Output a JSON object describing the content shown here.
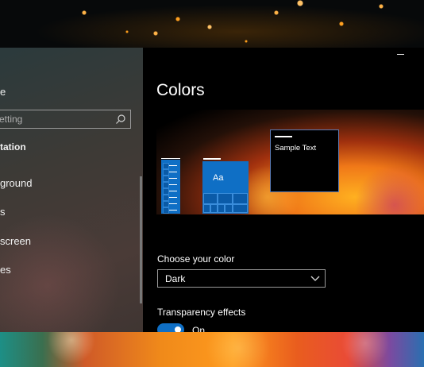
{
  "sidebar": {
    "home_partial": "e",
    "search_placeholder": "etting",
    "section_heading": "tation",
    "items": [
      {
        "label": "ground"
      },
      {
        "label": "s"
      },
      {
        "label": "screen"
      },
      {
        "label": "es"
      }
    ]
  },
  "page": {
    "title": "Colors",
    "preview": {
      "tile_text": "Aa",
      "sample_text": "Sample Text"
    },
    "choose_color": {
      "label": "Choose your color",
      "selected": "Dark"
    },
    "transparency": {
      "label": "Transparency effects",
      "state": "On",
      "enabled": true
    }
  },
  "colors": {
    "accent": "#0f6fc5",
    "background": "#000000"
  },
  "icons": [
    "search-icon",
    "chevron-down-icon",
    "minimize-icon"
  ]
}
